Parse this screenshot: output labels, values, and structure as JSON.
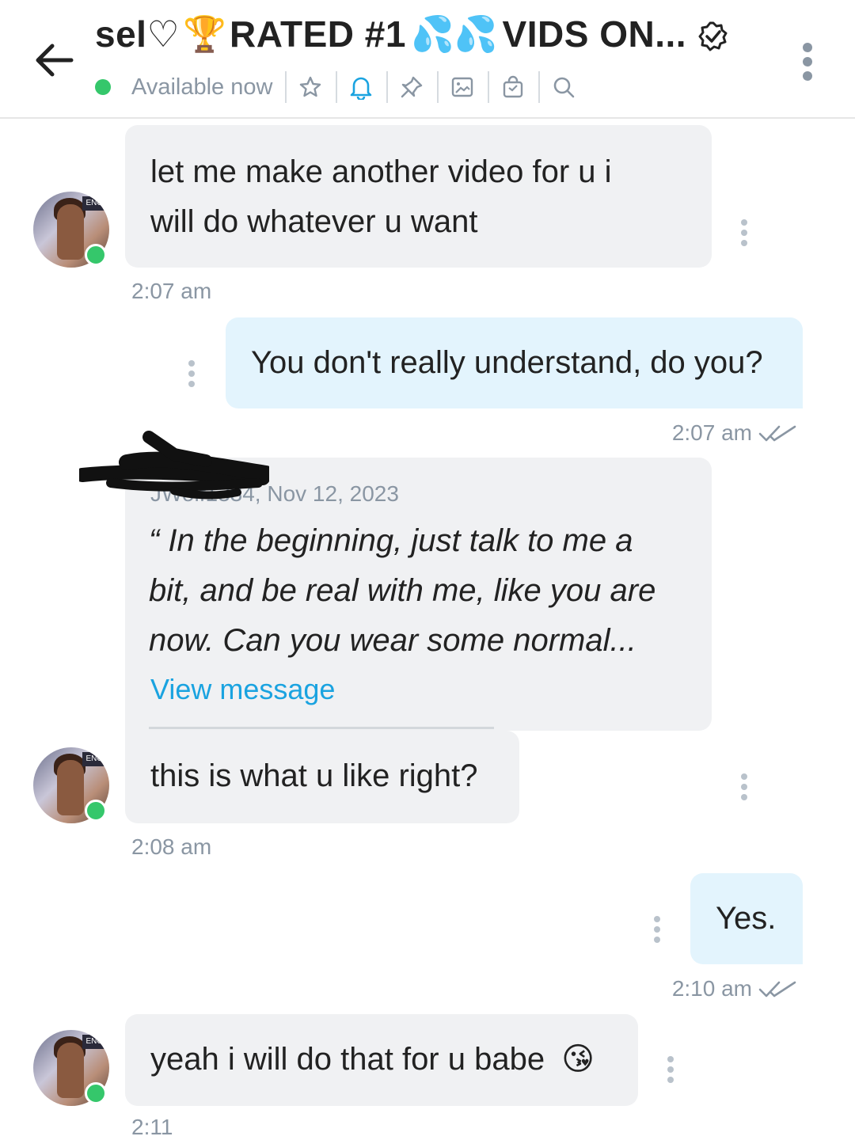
{
  "header": {
    "title_prefix": "sel♡",
    "title_emoji": "🏆",
    "title_middle": "RATED #1",
    "title_drops": "💦💦",
    "title_suffix": "VIDS ON...",
    "status": "Available now",
    "icons": [
      "back-arrow-icon",
      "verified-icon",
      "star-icon",
      "bell-icon",
      "pin-icon",
      "image-icon",
      "bag-icon",
      "search-icon",
      "more-vertical-icon"
    ],
    "accent_color": "#1aa3e0",
    "online_color": "#35c76b"
  },
  "messages": [
    {
      "direction": "in",
      "text_line1": "let me make another video for u i",
      "text_line2": "will do whatever u want",
      "time": "2:07 am"
    },
    {
      "direction": "out",
      "text": "You don't really understand, do you?",
      "time": "2:07 am"
    },
    {
      "direction": "in",
      "quote": {
        "author": "JWolf1334",
        "date": ", Nov 12, 2023",
        "line1": "“ In the beginning, just talk to me a",
        "line2": "bit, and be real with me, like you are",
        "line3": "now. Can you wear some normal...",
        "link": "View message"
      },
      "text": "this is what u like right?",
      "time": "2:08 am"
    },
    {
      "direction": "out",
      "text": "Yes.",
      "time": "2:10 am"
    },
    {
      "direction": "in",
      "text": "yeah i will do that for u babe",
      "emoji": "😘",
      "time": "2:11"
    }
  ],
  "avatar_sign": "ENC"
}
